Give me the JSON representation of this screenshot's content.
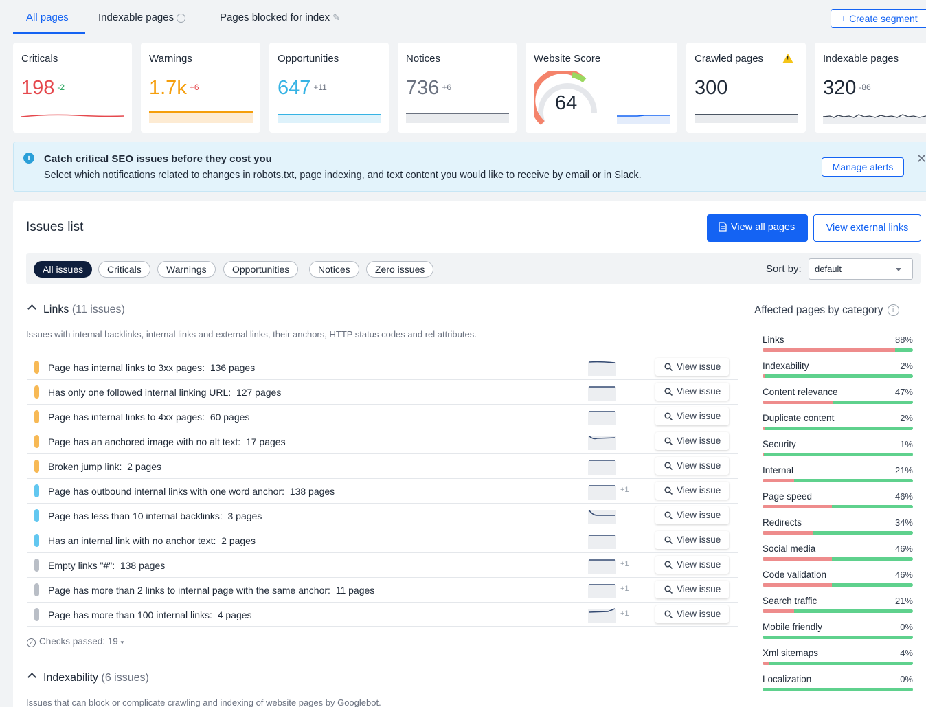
{
  "tabs": {
    "all_pages": "All pages",
    "indexable_pages": "Indexable pages",
    "blocked": "Pages blocked for index",
    "create_segment": "+ Create segment"
  },
  "cards": [
    {
      "title": "Criticals",
      "value": "198",
      "delta": "-2",
      "color": "#e5484d"
    },
    {
      "title": "Warnings",
      "value": "1.7k",
      "delta": "+6",
      "color": "#f59e0b"
    },
    {
      "title": "Opportunities",
      "value": "647",
      "delta": "+11",
      "color": "#36b3e4"
    },
    {
      "title": "Notices",
      "value": "736",
      "delta": "+6",
      "color": "#6b7280"
    },
    {
      "title": "Website Score",
      "value": "64"
    },
    {
      "title": "Crawled pages",
      "value": "300"
    },
    {
      "title": "Indexable pages",
      "value": "320",
      "delta": "-86"
    }
  ],
  "banner": {
    "title": "Catch critical SEO issues before they cost you",
    "text": "Select which notifications related to changes in robots.txt, page indexing, and text content you would like to receive by email or in Slack.",
    "button": "Manage alerts"
  },
  "issues": {
    "title": "Issues list",
    "view_all": "View all pages",
    "view_external": "View external links",
    "filters": [
      "All issues",
      "Criticals",
      "Warnings",
      "Opportunities",
      "Notices",
      "Zero issues"
    ],
    "sort_label": "Sort by:",
    "sort_value": "default"
  },
  "links_group": {
    "name": "Links",
    "count": "(11 issues)",
    "description": "Issues with internal backlinks, internal links and external links, their anchors, HTTP status codes and rel attributes.",
    "view_label": "View issue",
    "rows": [
      {
        "label": "Page has internal links to 3xx pages:",
        "pages": "136 pages",
        "severity": "warning",
        "plus": ""
      },
      {
        "label": "Has only one followed internal linking URL:",
        "pages": "127 pages",
        "severity": "warning",
        "plus": ""
      },
      {
        "label": "Page has internal links to 4xx pages:",
        "pages": "60 pages",
        "severity": "warning",
        "plus": ""
      },
      {
        "label": "Page has an anchored image with no alt text:",
        "pages": "17 pages",
        "severity": "warning",
        "plus": ""
      },
      {
        "label": "Broken jump link:",
        "pages": "2 pages",
        "severity": "warning",
        "plus": ""
      },
      {
        "label": "Page has outbound internal links with one word anchor:",
        "pages": "138 pages",
        "severity": "opportunity",
        "plus": "+1"
      },
      {
        "label": "Page has less than 10 internal backlinks:",
        "pages": "3 pages",
        "severity": "opportunity",
        "plus": ""
      },
      {
        "label": "Has an internal link with no anchor text:",
        "pages": "2 pages",
        "severity": "opportunity",
        "plus": ""
      },
      {
        "label": "Empty links \"#\":",
        "pages": "138 pages",
        "severity": "notice",
        "plus": "+1"
      },
      {
        "label": "Page has more than 2 links to internal page with the same anchor:",
        "pages": "11 pages",
        "severity": "notice",
        "plus": "+1"
      },
      {
        "label": "Page has more than 100 internal links:",
        "pages": "4 pages",
        "severity": "notice",
        "plus": "+1"
      }
    ],
    "checks_passed": "Checks passed: 19"
  },
  "indexability_group": {
    "name": "Indexability",
    "count": "(6 issues)",
    "description": "Issues that can block or complicate crawling and indexing of website pages by Googlebot."
  },
  "affected": {
    "title": "Affected pages by category",
    "categories": [
      {
        "name": "Links",
        "pct": "88%",
        "value": 0.88
      },
      {
        "name": "Indexability",
        "pct": "2%",
        "value": 0.02
      },
      {
        "name": "Content relevance",
        "pct": "47%",
        "value": 0.47
      },
      {
        "name": "Duplicate content",
        "pct": "2%",
        "value": 0.02
      },
      {
        "name": "Security",
        "pct": "1%",
        "value": 0.01
      },
      {
        "name": "Internal",
        "pct": "21%",
        "value": 0.21
      },
      {
        "name": "Page speed",
        "pct": "46%",
        "value": 0.46
      },
      {
        "name": "Redirects",
        "pct": "34%",
        "value": 0.34
      },
      {
        "name": "Social media",
        "pct": "46%",
        "value": 0.46
      },
      {
        "name": "Code validation",
        "pct": "46%",
        "value": 0.46
      },
      {
        "name": "Search traffic",
        "pct": "21%",
        "value": 0.21
      },
      {
        "name": "Mobile friendly",
        "pct": "0%",
        "value": 0.0
      },
      {
        "name": "Xml sitemaps",
        "pct": "4%",
        "value": 0.04
      },
      {
        "name": "Localization",
        "pct": "0%",
        "value": 0.0
      }
    ]
  },
  "colors": {
    "accent": "#1463f3",
    "warning": "#f7b955",
    "opportunity": "#62c7f0",
    "notice": "#b9bec6",
    "red_bar": "#ee8c8c",
    "green_bar": "#5fd18d"
  }
}
